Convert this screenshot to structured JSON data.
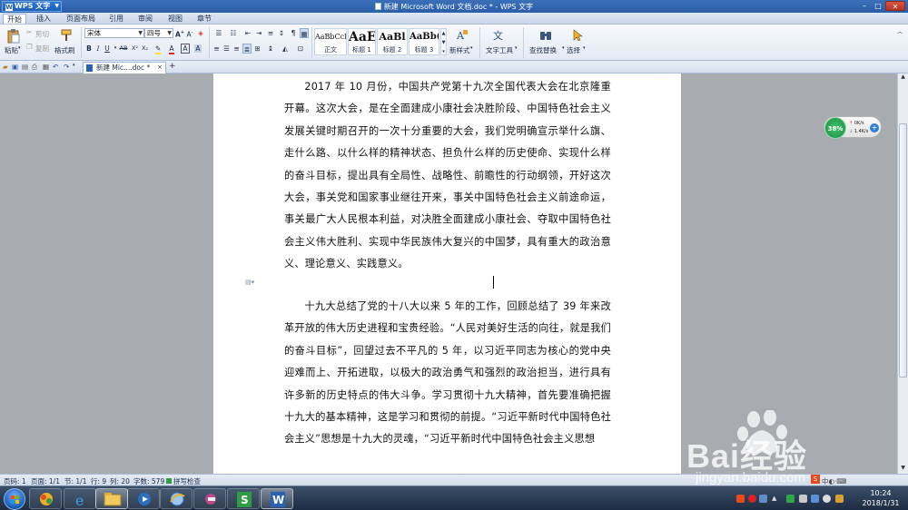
{
  "title_bar": {
    "app_name": "WPS 文字",
    "window_title": "新建 Microsoft Word 文档.doc * - WPS 文字"
  },
  "menu": {
    "items": [
      "开始",
      "插入",
      "页面布局",
      "引用",
      "审阅",
      "视图",
      "章节"
    ],
    "active": "开始"
  },
  "ribbon": {
    "clipboard": {
      "paste": "粘贴",
      "cut": "剪切",
      "copy": "复制",
      "format_painter": "格式刷"
    },
    "font": {
      "name": "宋体",
      "size": "四号"
    },
    "styles": [
      {
        "preview": "AaBbCcDd",
        "label": "正文"
      },
      {
        "preview": "AaE",
        "label": "标题 1"
      },
      {
        "preview": "AaBl",
        "label": "标题 2"
      },
      {
        "preview": "AaBb(",
        "label": "标题 3"
      }
    ],
    "new_style": "新样式",
    "text_tools": "文字工具",
    "find_replace": "查找替换",
    "select": "选择"
  },
  "tabs": {
    "doc_tab_label": "新建 Mic....doc *"
  },
  "document": {
    "paragraphs": [
      "2017 年 10 月份，中国共产党第十九次全国代表大会在北京隆重开幕。这次大会，是在全面建成小康社会决胜阶段、中国特色社会主义发展关键时期召开的一次十分重要的大会，我们党明确宣示举什么旗、走什么路、以什么样的精神状态、担负什么样的历史使命、实现什么样的奋斗目标，提出具有全局性、战略性、前瞻性的行动纲领，开好这次大会，事关党和国家事业继往开来，事关中国特色社会主义前途命运，事关最广大人民根本利益，对决胜全面建成小康社会、夺取中国特色社会主义伟大胜利、实现中华民族伟大复兴的中国梦，具有重大的政治意义、理论意义、实践意义。",
      "十九大总结了党的十八大以来 5 年的工作，回顾总结了 39 年来改革开放的伟大历史进程和宝贵经验。“人民对美好生活的向往，就是我们的奋斗目标”，回望过去不平凡的 5 年，以习近平同志为核心的党中央迎难而上、开拓进取，以极大的政治勇气和强烈的政治担当，进行具有许多新的历史特点的伟大斗争。学习贯彻十九大精神，首先要准确把握十九大的基本精神，这是学习和贯彻的前提。“习近平新时代中国特色社会主义”思想是十九大的灵魂，“习近平新时代中国特色社会主义思想"
    ]
  },
  "net_widget": {
    "percent": "38%",
    "up_speed": "0K/s",
    "down_speed": "1.4K/s"
  },
  "status_bar": {
    "page_no": "页码: 1",
    "pages": "页面: 1/1",
    "section": "节: 1/1",
    "row": "行: 9",
    "column": "列: 20",
    "word_count": "字数: 579",
    "spell_check": "拼写检查"
  },
  "watermark": {
    "brand": "Bai经验",
    "url": "jingyan.baidu.com"
  },
  "taskbar": {
    "time": "10:24",
    "date": "2018/1/31"
  },
  "colors": {
    "title_bar": "#2a5ea8",
    "active_menu": "#ffffff",
    "taskbar": "#1d2c41",
    "wps_writer": "#2b61b5",
    "wps_sheet": "#2f9d44"
  }
}
